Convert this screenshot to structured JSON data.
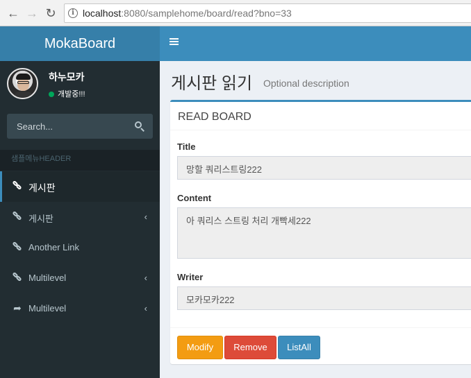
{
  "browser": {
    "url_host": "localhost",
    "url_path": ":8080/samplehome/board/read?bno=33"
  },
  "header": {
    "logo": "MokaBoard"
  },
  "user": {
    "name": "하누모카",
    "status": "개발중!!!"
  },
  "search": {
    "placeholder": "Search..."
  },
  "sidebar": {
    "header": "샘플메뉴HEADER",
    "items": [
      {
        "label": "게시판",
        "icon": "link-icon",
        "active": true
      },
      {
        "label": "게시판",
        "icon": "link-icon",
        "has_children": true
      },
      {
        "label": "Another Link",
        "icon": "link-icon"
      },
      {
        "label": "Multilevel",
        "icon": "link-icon",
        "has_children": true
      },
      {
        "label": "Multilevel",
        "icon": "share-icon",
        "has_children": true
      }
    ]
  },
  "page": {
    "title": "게시판 읽기",
    "description": "Optional description"
  },
  "board": {
    "box_title": "READ BOARD",
    "title_label": "Title",
    "title_value": "망할 쿼리스트링222",
    "content_label": "Content",
    "content_value": "아 쿼리스 스트링 처리 개빡세222",
    "writer_label": "Writer",
    "writer_value": "모카모카222"
  },
  "buttons": {
    "modify": "Modify",
    "remove": "Remove",
    "list": "ListAll"
  },
  "colors": {
    "primary": "#3c8dbc",
    "sidebar": "#222d32",
    "warning": "#f39c12",
    "danger": "#dd4b39"
  }
}
